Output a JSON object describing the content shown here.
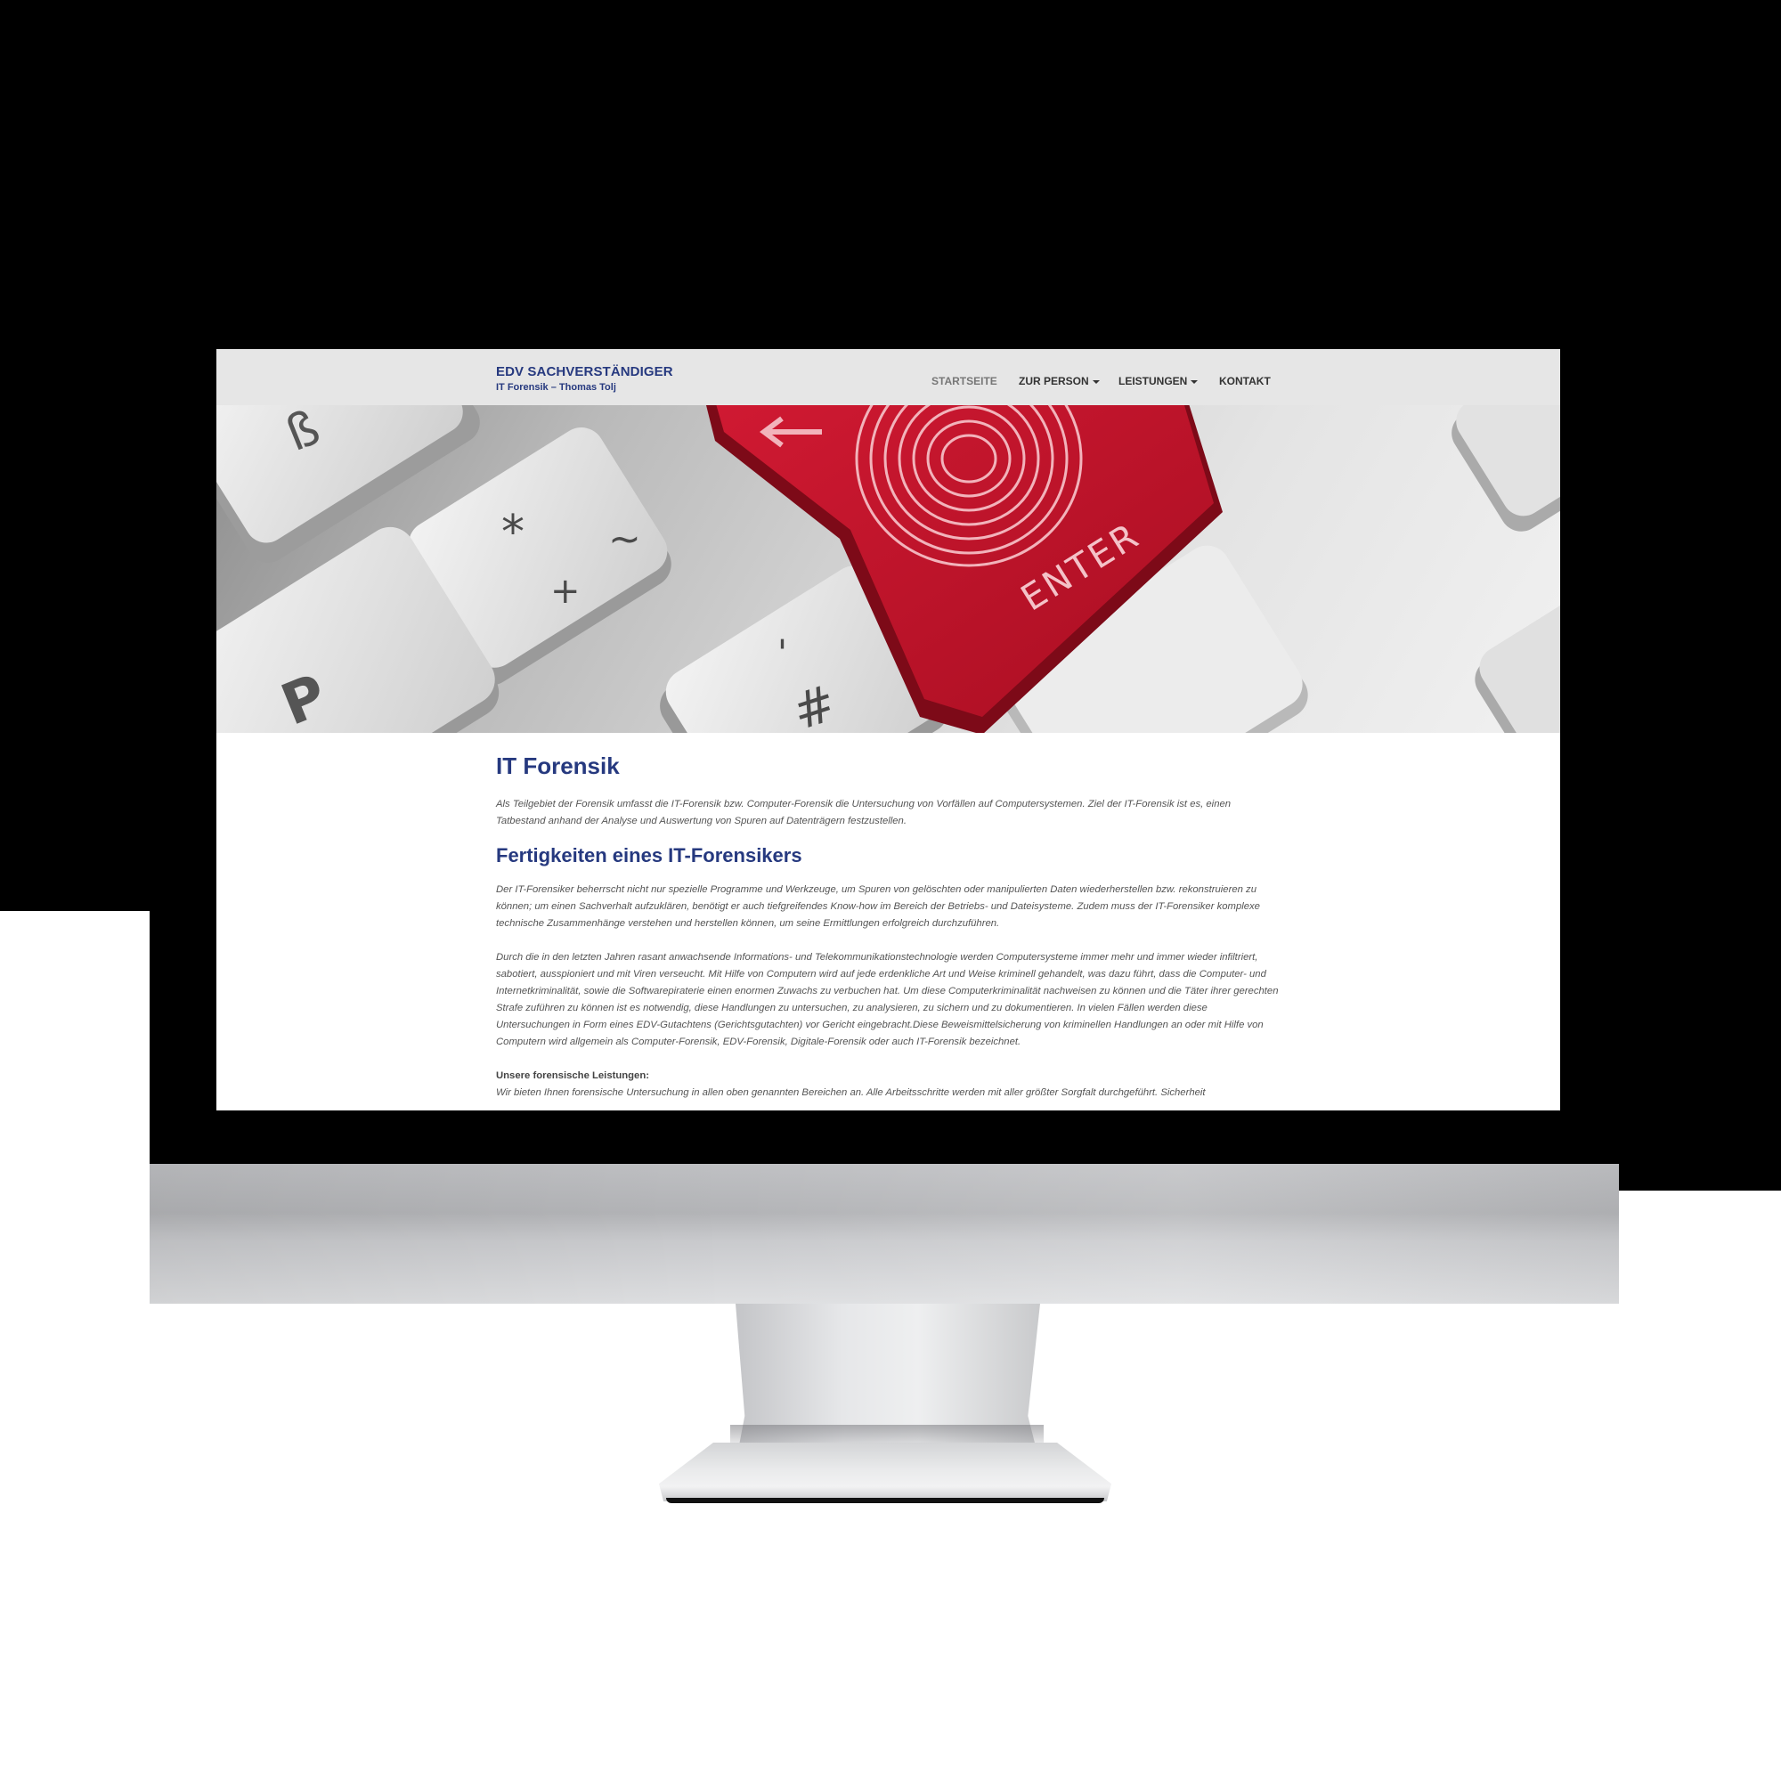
{
  "navbar": {
    "brand_title": "EDV SACHVERSTÄNDIGER",
    "brand_subtitle": "IT Forensik – Thomas Tolj",
    "items": [
      {
        "label": "STARTSEITE"
      },
      {
        "label": "ZUR PERSON"
      },
      {
        "label": "LEISTUNGEN"
      },
      {
        "label": "KONTAKT"
      }
    ]
  },
  "hero": {
    "keys": [
      "ß",
      "*",
      "~",
      "+",
      "P",
      "'",
      "#"
    ],
    "enter_label": "ENTER"
  },
  "main": {
    "heading": "IT Forensik",
    "intro": "Als Teilgebiet der Forensik umfasst die IT-Forensik bzw. Computer-Forensik die Untersuchung von Vorfällen auf Computersystemen. Ziel der IT-Forensik ist es, einen Tatbestand anhand der Analyse und Auswertung von Spuren auf Datenträgern festzustellen.",
    "subheading": "Fertigkeiten eines IT-Forensikers",
    "paragraph1": "Der IT-Forensiker beherrscht nicht nur spezielle Programme und Werkzeuge, um Spuren von gelöschten oder manipulierten Daten wiederherstellen bzw. rekonstruieren zu können; um einen Sachverhalt aufzuklären, benötigt er auch tiefgreifendes Know-how im Bereich der Betriebs- und Dateisysteme. Zudem muss der IT-Forensiker komplexe technische Zusammenhänge verstehen und herstellen können, um seine Ermittlungen erfolgreich durchzuführen.",
    "paragraph2": "Durch die in den letzten Jahren rasant anwachsende Informations- und Telekommunikationstechnologie werden Computersysteme immer mehr und immer wieder infiltriert, sabotiert, ausspioniert und mit Viren verseucht. Mit Hilfe von Computern wird auf jede erdenkliche Art und Weise kriminell gehandelt, was dazu führt, dass die Computer- und Internetkriminalität, sowie die Softwarepiraterie einen enormen Zuwachs zu verbuchen hat. Um diese Computerkriminalität nachweisen zu können und die Täter ihrer gerechten Strafe zuführen zu können ist es notwendig, diese Handlungen zu untersuchen, zu analysieren, zu sichern und zu dokumentieren. In vielen Fällen werden diese Untersuchungen in Form eines EDV-Gutachtens (Gerichtsgutachten) vor Gericht eingebracht.Diese Beweismittelsicherung von kriminellen Handlungen an oder mit Hilfe von Computern wird allgemein als Computer-Forensik, EDV-Forensik, Digitale-Forensik oder auch IT-Forensik bezeichnet.",
    "services_label": "Unsere forensische Leistungen:",
    "services_text": "Wir bieten Ihnen forensische Untersuchung in allen oben genannten Bereichen an. Alle Arbeitsschritte werden mit aller größter Sorgfalt durchgeführt. Sicherheit"
  },
  "colors": {
    "brand": "#26397f",
    "enter_key": "#c4122a",
    "navbar_bg": "#e6e6e6"
  }
}
